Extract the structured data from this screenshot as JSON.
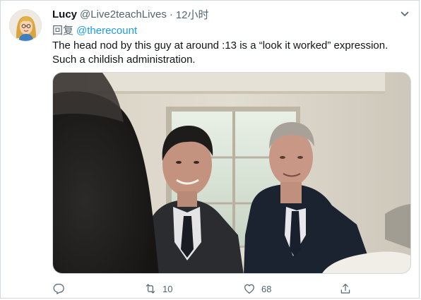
{
  "tweet": {
    "display_name": "Lucy",
    "handle": "@Live2teachLives",
    "separator": "·",
    "time": "12小时",
    "reply_prefix": "回复",
    "reply_mention": "@therecount",
    "text_line1": "The head nod by this guy at around :13 is a “look it worked” expression.",
    "text_line2": "Such a childish administration."
  },
  "actions": {
    "reply_icon": "reply-icon",
    "retweet_icon": "retweet-icon",
    "retweet_count": "10",
    "like_icon": "like-icon",
    "like_count": "68",
    "share_icon": "share-icon"
  },
  "colors": {
    "link": "#1d9bf0",
    "muted": "#536471",
    "text": "#0f1419",
    "border": "#cfd9de"
  }
}
